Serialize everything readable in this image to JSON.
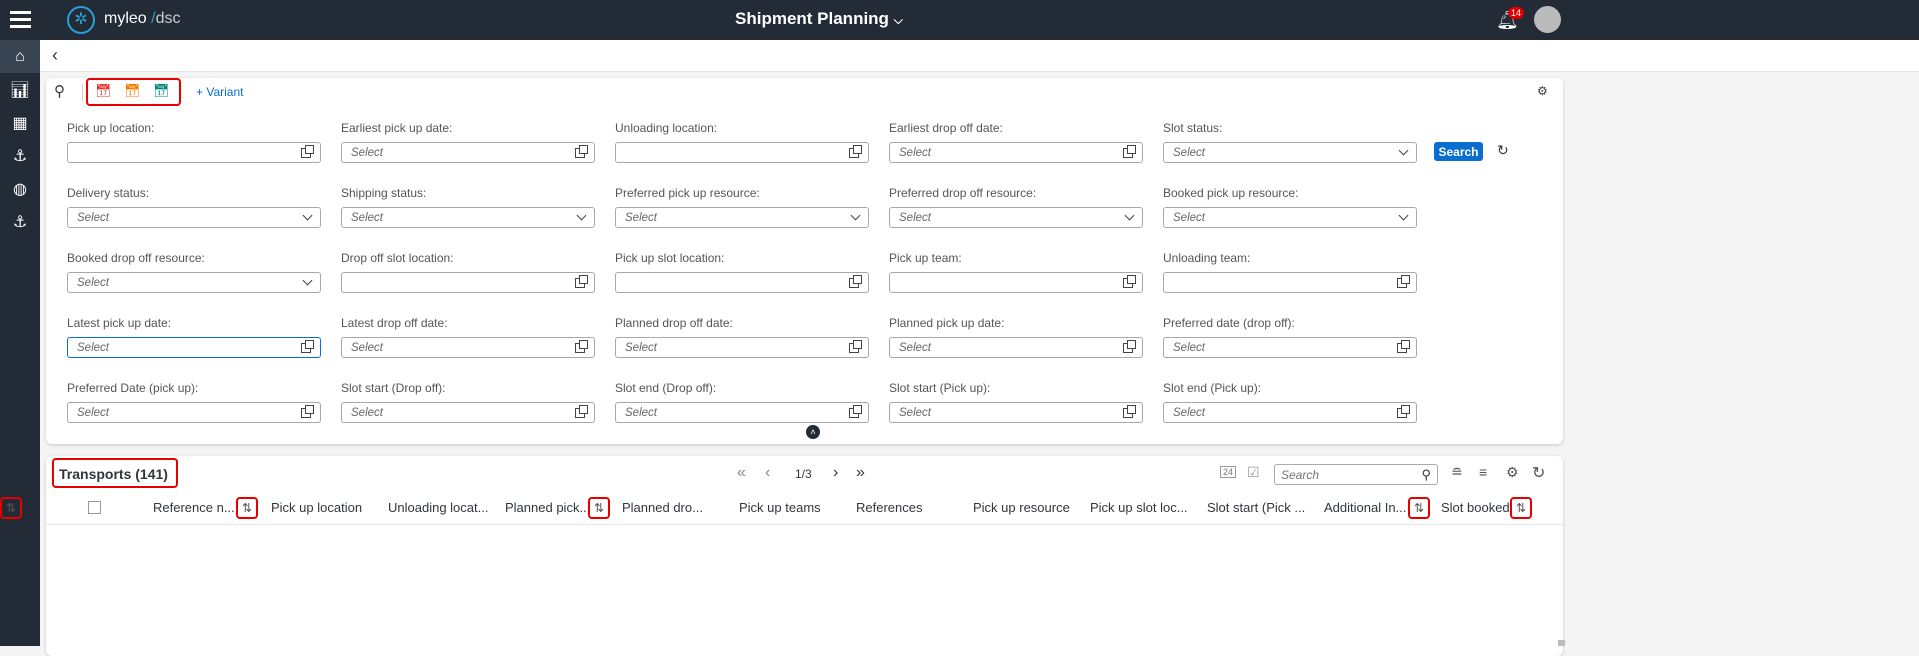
{
  "header": {
    "brand": "myleo",
    "brand_suffix": "/",
    "brand_product": "dsc",
    "title": "Shipment Planning",
    "notification_count": "14"
  },
  "filterbar": {
    "variant_label": "+ Variant",
    "search_button": "Search",
    "fields": [
      {
        "label": "Pick up location:",
        "value": "",
        "type": "valuehelp"
      },
      {
        "label": "Earliest pick up date:",
        "value": "Select",
        "type": "valuehelp"
      },
      {
        "label": "Unloading location:",
        "value": "",
        "type": "valuehelp"
      },
      {
        "label": "Earliest drop off date:",
        "value": "Select",
        "type": "valuehelp"
      },
      {
        "label": "Slot status:",
        "value": "Select",
        "type": "select"
      },
      {
        "label": "Delivery status:",
        "value": "Select",
        "type": "select"
      },
      {
        "label": "Shipping status:",
        "value": "Select",
        "type": "select"
      },
      {
        "label": "Preferred pick up resource:",
        "value": "Select",
        "type": "select"
      },
      {
        "label": "Preferred drop off resource:",
        "value": "Select",
        "type": "select"
      },
      {
        "label": "Booked pick up resource:",
        "value": "Select",
        "type": "select"
      },
      {
        "label": "Booked drop off resource:",
        "value": "Select",
        "type": "select"
      },
      {
        "label": "Drop off slot location:",
        "value": "",
        "type": "valuehelp"
      },
      {
        "label": "Pick up slot location:",
        "value": "",
        "type": "valuehelp"
      },
      {
        "label": "Pick up team:",
        "value": "",
        "type": "valuehelp"
      },
      {
        "label": "Unloading team:",
        "value": "",
        "type": "valuehelp"
      },
      {
        "label": "Latest pick up date:",
        "value": "Select",
        "type": "valuehelp"
      },
      {
        "label": "Latest drop off date:",
        "value": "Select",
        "type": "valuehelp"
      },
      {
        "label": "Planned drop off date:",
        "value": "Select",
        "type": "valuehelp"
      },
      {
        "label": "Planned pick up date:",
        "value": "Select",
        "type": "valuehelp"
      },
      {
        "label": "Preferred date (drop off):",
        "value": "Select",
        "type": "valuehelp"
      },
      {
        "label": "Preferred Date (pick up):",
        "value": "Select",
        "type": "valuehelp"
      },
      {
        "label": "Slot start (Drop off):",
        "value": "Select",
        "type": "valuehelp"
      },
      {
        "label": "Slot end (Drop off):",
        "value": "Select",
        "type": "valuehelp"
      },
      {
        "label": "Slot start (Pick up):",
        "value": "Select",
        "type": "valuehelp"
      },
      {
        "label": "Slot end (Pick up):",
        "value": "Select",
        "type": "valuehelp"
      }
    ]
  },
  "table": {
    "title": "Transports (141)",
    "page": "1/3",
    "search_placeholder": "Search",
    "date_icon_text": "24",
    "columns": [
      {
        "label": "Reference n...",
        "sortable": true
      },
      {
        "label": "Pick up location",
        "sortable": false
      },
      {
        "label": "Unloading locat...",
        "sortable": false
      },
      {
        "label": "Planned pick...",
        "sortable": true
      },
      {
        "label": "Planned dro...",
        "sortable": true
      },
      {
        "label": "Pick up teams",
        "sortable": false
      },
      {
        "label": "References",
        "sortable": false
      },
      {
        "label": "Pick up resource",
        "sortable": false
      },
      {
        "label": "Pick up slot loc...",
        "sortable": false
      },
      {
        "label": "Slot start (Pick ...",
        "sortable": false
      },
      {
        "label": "Additional In...",
        "sortable": true
      },
      {
        "label": "Slot booked",
        "sortable": true
      }
    ]
  },
  "icons": {
    "sort": "⇅"
  },
  "colors": {
    "topbar": "#232b36",
    "accent": "#0a6ed1",
    "highlight": "#e60000"
  }
}
